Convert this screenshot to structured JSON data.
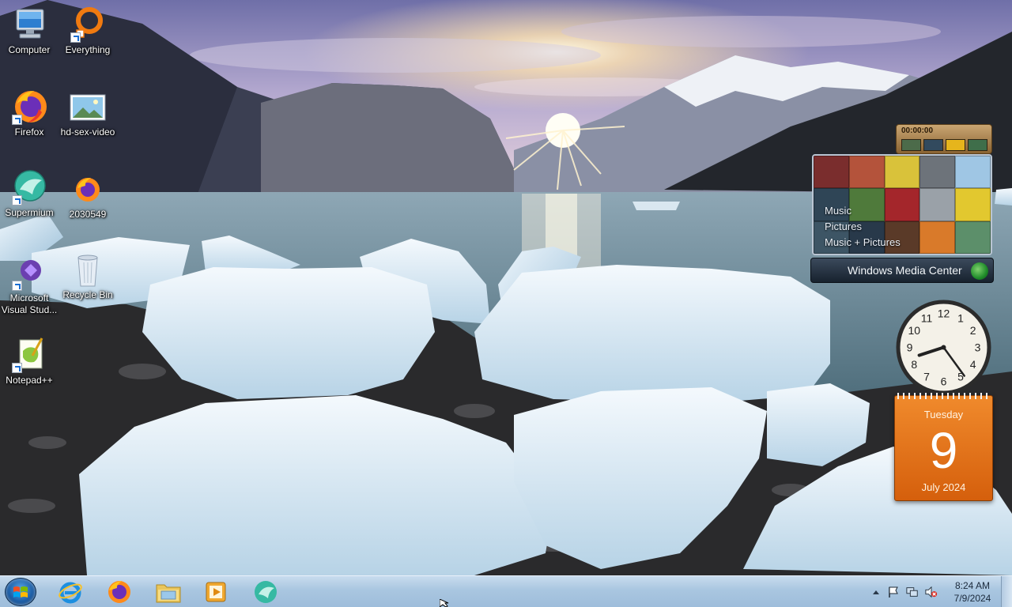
{
  "desktop": {
    "icons": [
      {
        "label": "Computer",
        "icon": "computer-icon"
      },
      {
        "label": "Everything",
        "icon": "everything-search-icon"
      },
      {
        "label": "Firefox",
        "icon": "firefox-icon"
      },
      {
        "label": "hd-sex-video",
        "icon": "image-file-icon"
      },
      {
        "label": "Supermium",
        "icon": "supermium-icon"
      },
      {
        "label": "2030549",
        "icon": "firefox-file-icon"
      },
      {
        "label": "Microsoft Visual Stud...",
        "icon": "visual-studio-icon"
      },
      {
        "label": "Recycle Bin",
        "icon": "recycle-bin-icon"
      },
      {
        "label": "Notepad++",
        "icon": "notepadpp-icon"
      }
    ]
  },
  "gadgets": {
    "media_center": {
      "timer": "00:00:00",
      "menu": [
        "Music",
        "Pictures",
        "Music + Pictures"
      ],
      "title": "Windows Media Center"
    },
    "clock": {
      "hour": 8,
      "minute": 24
    },
    "calendar": {
      "weekday": "Tuesday",
      "day": "9",
      "month_year": "July 2024"
    }
  },
  "taskbar": {
    "pinned": [
      {
        "name": "internet-explorer",
        "icon": "ie-icon"
      },
      {
        "name": "firefox",
        "icon": "firefox-icon"
      },
      {
        "name": "file-explorer",
        "icon": "folder-icon"
      },
      {
        "name": "media-player",
        "icon": "media-player-icon"
      },
      {
        "name": "supermium",
        "icon": "supermium-icon"
      }
    ],
    "tray": {
      "icons": [
        "show-hidden-icons-arrow",
        "action-center-flag-icon",
        "network-icon",
        "volume-muted-icon"
      ],
      "time": "8:24 AM",
      "date": "7/9/2024"
    }
  },
  "colors": {
    "taskbar": "#a9c6e0",
    "calendar": "#e4700f",
    "media_center_bar": "#1f2b38"
  }
}
